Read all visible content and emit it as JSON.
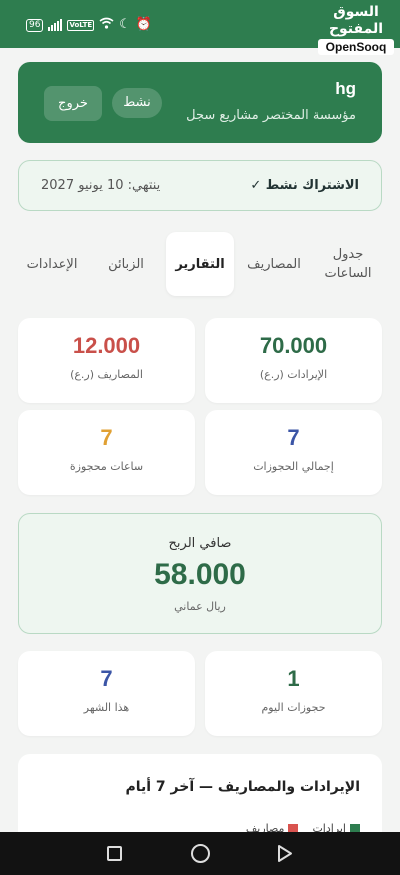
{
  "status_bar": {
    "battery": "96",
    "network": "VoLTE",
    "brand_arabic": "السوق المفتوح",
    "brand_english": "OpenSooq"
  },
  "header": {
    "user_name": "hg",
    "organization": "مؤسسة المختصر مشاريع سجل",
    "active_badge": "نشط",
    "logout_label": "خروج",
    "accent_color": "#2e7d4f"
  },
  "subscription": {
    "status": "الاشتراك نشط ✓",
    "expiry": "ينتهي: 10 يونيو 2027"
  },
  "tabs": [
    {
      "label": "جدول الساعات",
      "active": false
    },
    {
      "label": "المصاريف",
      "active": false
    },
    {
      "label": "التقارير",
      "active": true
    },
    {
      "label": "الزبائن",
      "active": false
    },
    {
      "label": "الإعدادات",
      "active": false
    }
  ],
  "stats": {
    "revenue": {
      "value": "70.000",
      "label": "الإيرادات (ر.ع)",
      "color": "#2e6b48"
    },
    "expenses": {
      "value": "12.000",
      "label": "المصاريف (ر.ع)",
      "color": "#c9504a"
    },
    "total_bookings": {
      "value": "7",
      "label": "إجمالي الحجوزات",
      "color": "#3b55a6"
    },
    "booked_hours": {
      "value": "7",
      "label": "ساعات محجوزة",
      "color": "#e0a033"
    },
    "today_bookings": {
      "value": "1",
      "label": "حجوزات اليوم",
      "color": "#2e6b48"
    },
    "this_month": {
      "value": "7",
      "label": "هذا الشهر",
      "color": "#3b55a6"
    }
  },
  "net_profit": {
    "title": "صافي الربح",
    "value": "58.000",
    "currency": "ريال عماني"
  },
  "chart_card": {
    "title": "الإيرادات والمصاريف — آخر 7 أيام",
    "legend": [
      {
        "label": "إيرادات",
        "color": "#2e7d4f"
      },
      {
        "label": "مصاريف",
        "color": "#d9534f"
      }
    ]
  }
}
